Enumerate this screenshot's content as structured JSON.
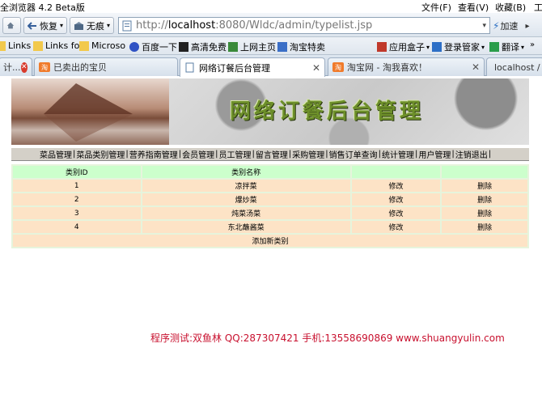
{
  "browser": {
    "app_title": "全浏览器 4.2 Beta版",
    "menu": [
      "文件(F)",
      "查看(V)",
      "收藏(B)",
      "工"
    ],
    "back_label": "恢复",
    "tools_label": "无痕",
    "url_prefix": "http://",
    "url_host": "localhost",
    "url_rest": ":8080/Wldc/admin/typelist.jsp",
    "speed_label": "加速",
    "bookmarks": [
      "Links",
      "Links fo",
      "Microso",
      "百度一下",
      "高清免费",
      "上网主页",
      "淘宝特卖",
      "应用盒子",
      "登录管家",
      "翻译"
    ],
    "tabs": [
      {
        "label": "计..."
      },
      {
        "label": "已卖出的宝贝"
      },
      {
        "label": "网络订餐后台管理"
      },
      {
        "label": "淘宝网 - 淘我喜欢！"
      },
      {
        "label": "localhost / lo"
      }
    ]
  },
  "page": {
    "banner_title": "网络订餐后台管理",
    "nav": [
      "菜品管理",
      "菜品类别管理",
      "营养指南管理",
      "会员管理",
      "员工管理",
      "留言管理",
      "采购管理",
      "销售订单查询",
      "统计管理",
      "用户管理",
      "注销退出"
    ],
    "table": {
      "headers": [
        "类别ID",
        "类别名称",
        "",
        ""
      ],
      "rows": [
        {
          "id": "1",
          "name": "凉拌菜",
          "edit": "修改",
          "delete": "删除"
        },
        {
          "id": "2",
          "name": "爆炒菜",
          "edit": "修改",
          "delete": "删除"
        },
        {
          "id": "3",
          "name": "炖菜汤菜",
          "edit": "修改",
          "delete": "删除"
        },
        {
          "id": "4",
          "name": "东北蘸酱菜",
          "edit": "修改",
          "delete": "删除"
        }
      ],
      "add_label": "添加新类别"
    },
    "footer": "程序测试:双鱼林 QQ:287307421 手机:13558690869 www.shuangyulin.com"
  },
  "colors": {
    "header_row": "#ccffcc",
    "body_row": "#fde3c6",
    "footer_text": "#c8102e"
  }
}
